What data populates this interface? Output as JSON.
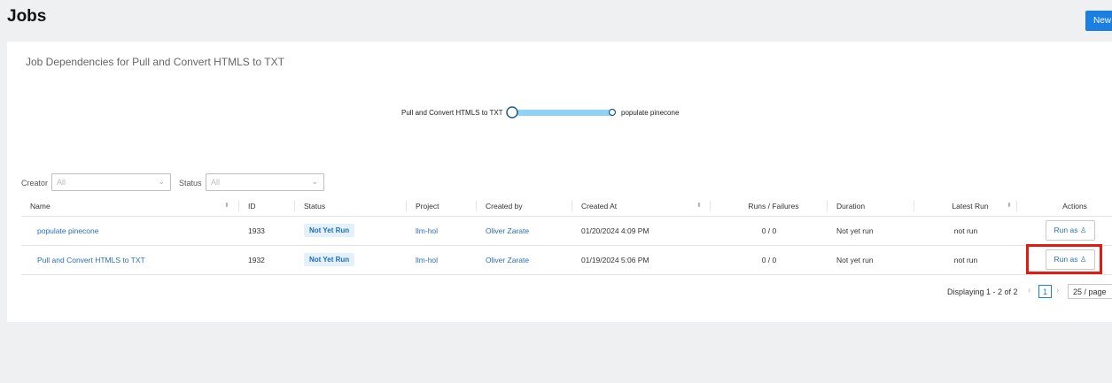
{
  "header": {
    "title": "Jobs",
    "new_button": "New"
  },
  "panel": {
    "title": "Job Dependencies for Pull and Convert HTMLS to TXT"
  },
  "graph": {
    "source_node": "Pull and Convert HTMLS to TXT",
    "target_node": "populate pinecone",
    "edge_color": "#8fd3f4"
  },
  "filters": {
    "creator_label": "Creator",
    "creator_value": "All",
    "status_label": "Status",
    "status_value": "All"
  },
  "table": {
    "columns": [
      "Name",
      "ID",
      "Status",
      "Project",
      "Created by",
      "Created At",
      "Runs / Failures",
      "Duration",
      "Latest Run",
      "Actions"
    ],
    "rows": [
      {
        "name": "populate pinecone",
        "id": "1933",
        "status": "Not Yet Run",
        "project": "llm-hol",
        "created_by": "Oliver Zarate",
        "created_at": "01/20/2024 4:09 PM",
        "runs_failures": "0 / 0",
        "duration": "Not yet run",
        "latest_run": "not run",
        "action": "Run as"
      },
      {
        "name": "Pull and Convert HTMLS to TXT",
        "id": "1932",
        "status": "Not Yet Run",
        "project": "llm-hol",
        "created_by": "Oliver Zarate",
        "created_at": "01/19/2024 5:06 PM",
        "runs_failures": "0 / 0",
        "duration": "Not yet run",
        "latest_run": "not run",
        "action": "Run as"
      }
    ]
  },
  "pagination": {
    "summary": "Displaying 1 - 2 of 2",
    "current_page": "1",
    "page_size": "25 / page"
  },
  "colors": {
    "accent": "#1a7fe0",
    "highlight": "#e01b0f",
    "link": "#2a6ebb"
  }
}
